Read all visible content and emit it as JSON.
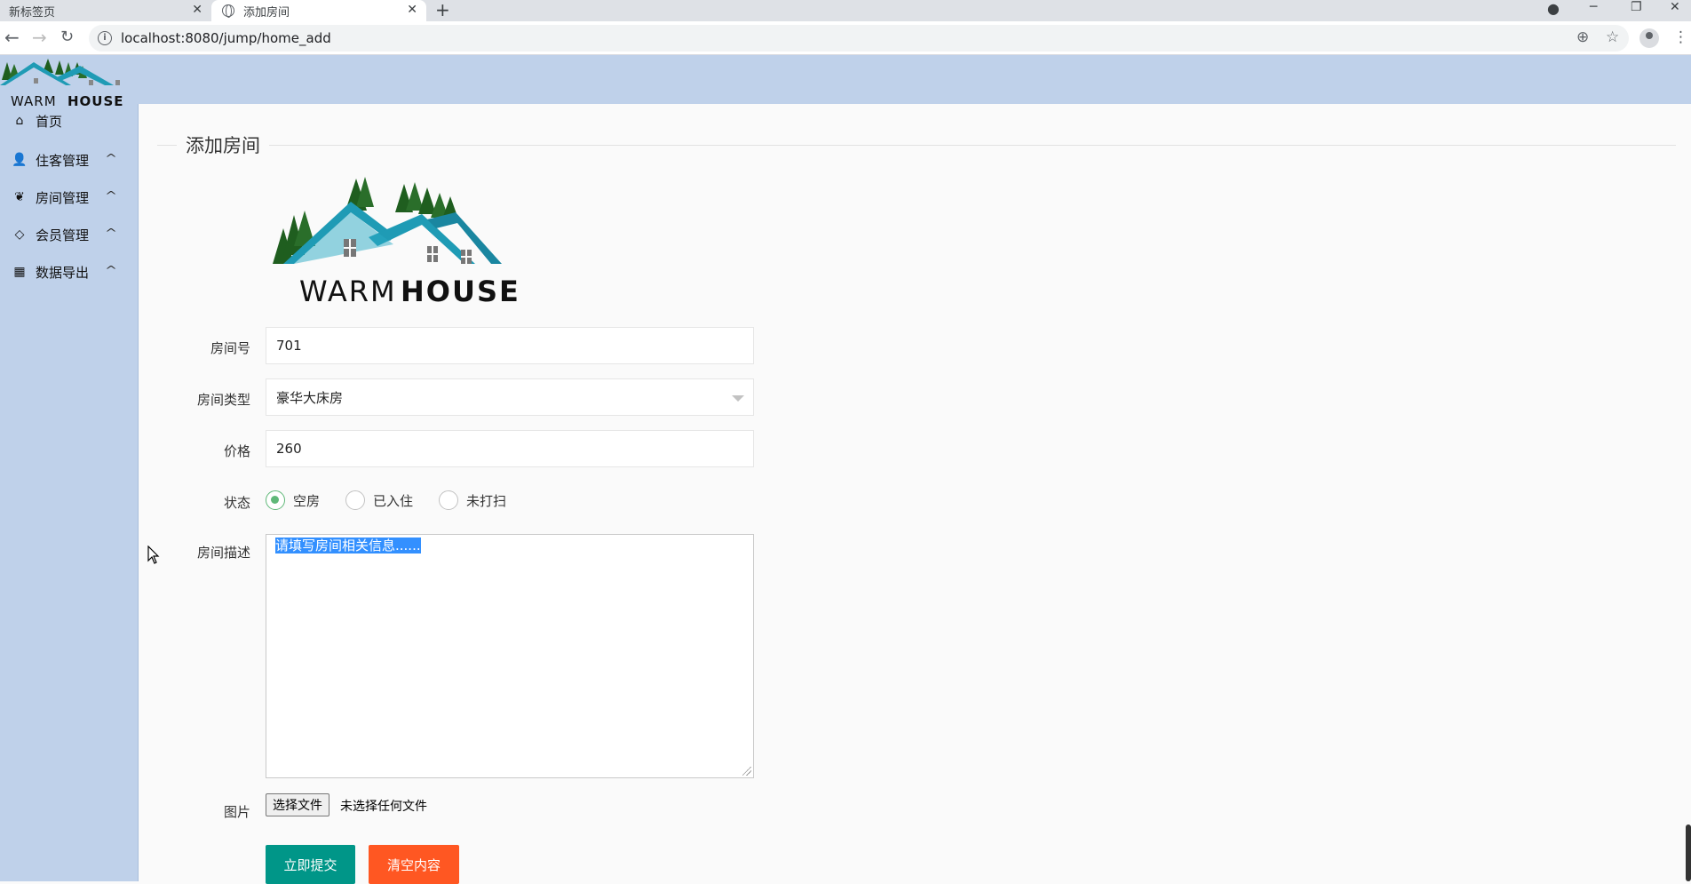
{
  "browser": {
    "tabs": [
      {
        "label": "新标签页"
      },
      {
        "label": "添加房间"
      }
    ],
    "url": "localhost:8080/jump/home_add"
  },
  "logo": {
    "text_warm": "WARM",
    "text_house": "HOUSE",
    "colors": {
      "roof": "#1f9bb5",
      "trees": "#1f5e1f",
      "text": "#111111"
    }
  },
  "sidebar": {
    "items": [
      {
        "label": "首页",
        "icon": "home-icon"
      },
      {
        "label": "住客管理",
        "icon": "user-icon"
      },
      {
        "label": "房间管理",
        "icon": "palm-icon"
      },
      {
        "label": "会员管理",
        "icon": "diamond-icon"
      },
      {
        "label": "数据导出",
        "icon": "table-icon"
      }
    ]
  },
  "form": {
    "title": "添加房间",
    "room_number": {
      "label": "房间号",
      "value": "701"
    },
    "room_type": {
      "label": "房间类型",
      "value": "豪华大床房"
    },
    "price": {
      "label": "价格",
      "value": "260"
    },
    "status": {
      "label": "状态",
      "options": [
        "空房",
        "已入住",
        "未打扫"
      ],
      "selected": "空房"
    },
    "description": {
      "label": "房间描述",
      "value": "请填写房间相关信息......"
    },
    "image": {
      "label": "图片",
      "button": "选择文件",
      "status": "未选择任何文件"
    },
    "submit_label": "立即提交",
    "reset_label": "清空内容"
  },
  "colors": {
    "header_bg": "#bfd1ea",
    "submit": "#009688",
    "reset": "#ff5722",
    "radio_active": "#5fb878"
  }
}
